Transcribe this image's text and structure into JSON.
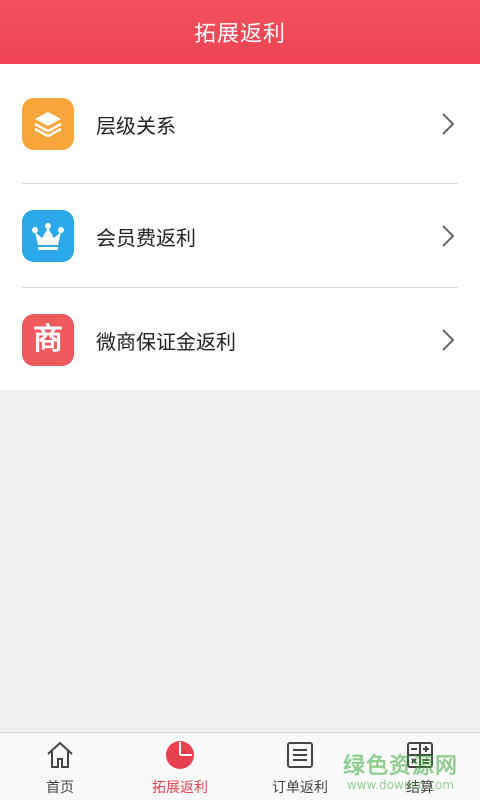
{
  "header": {
    "title": "拓展返利"
  },
  "menu": {
    "items": [
      {
        "label": "层级关系",
        "icon": "layers-icon",
        "color": "#f7a63a"
      },
      {
        "label": "会员费返利",
        "icon": "crown-icon",
        "color": "#2aa8e8"
      },
      {
        "label": "微商保证金返利",
        "icon_text": "商",
        "color": "#ef5a5f"
      }
    ]
  },
  "tabbar": {
    "tabs": [
      {
        "label": "首页",
        "icon": "home-icon"
      },
      {
        "label": "拓展返利",
        "icon": "pie-chart-icon",
        "active": true
      },
      {
        "label": "订单返利",
        "icon": "list-icon"
      },
      {
        "label": "结算",
        "icon": "calculator-icon"
      }
    ]
  },
  "watermark": {
    "main": "绿色资源网",
    "sub": "www.downcc.com"
  },
  "colors": {
    "primary": "#ee4352",
    "background": "#efefef"
  }
}
